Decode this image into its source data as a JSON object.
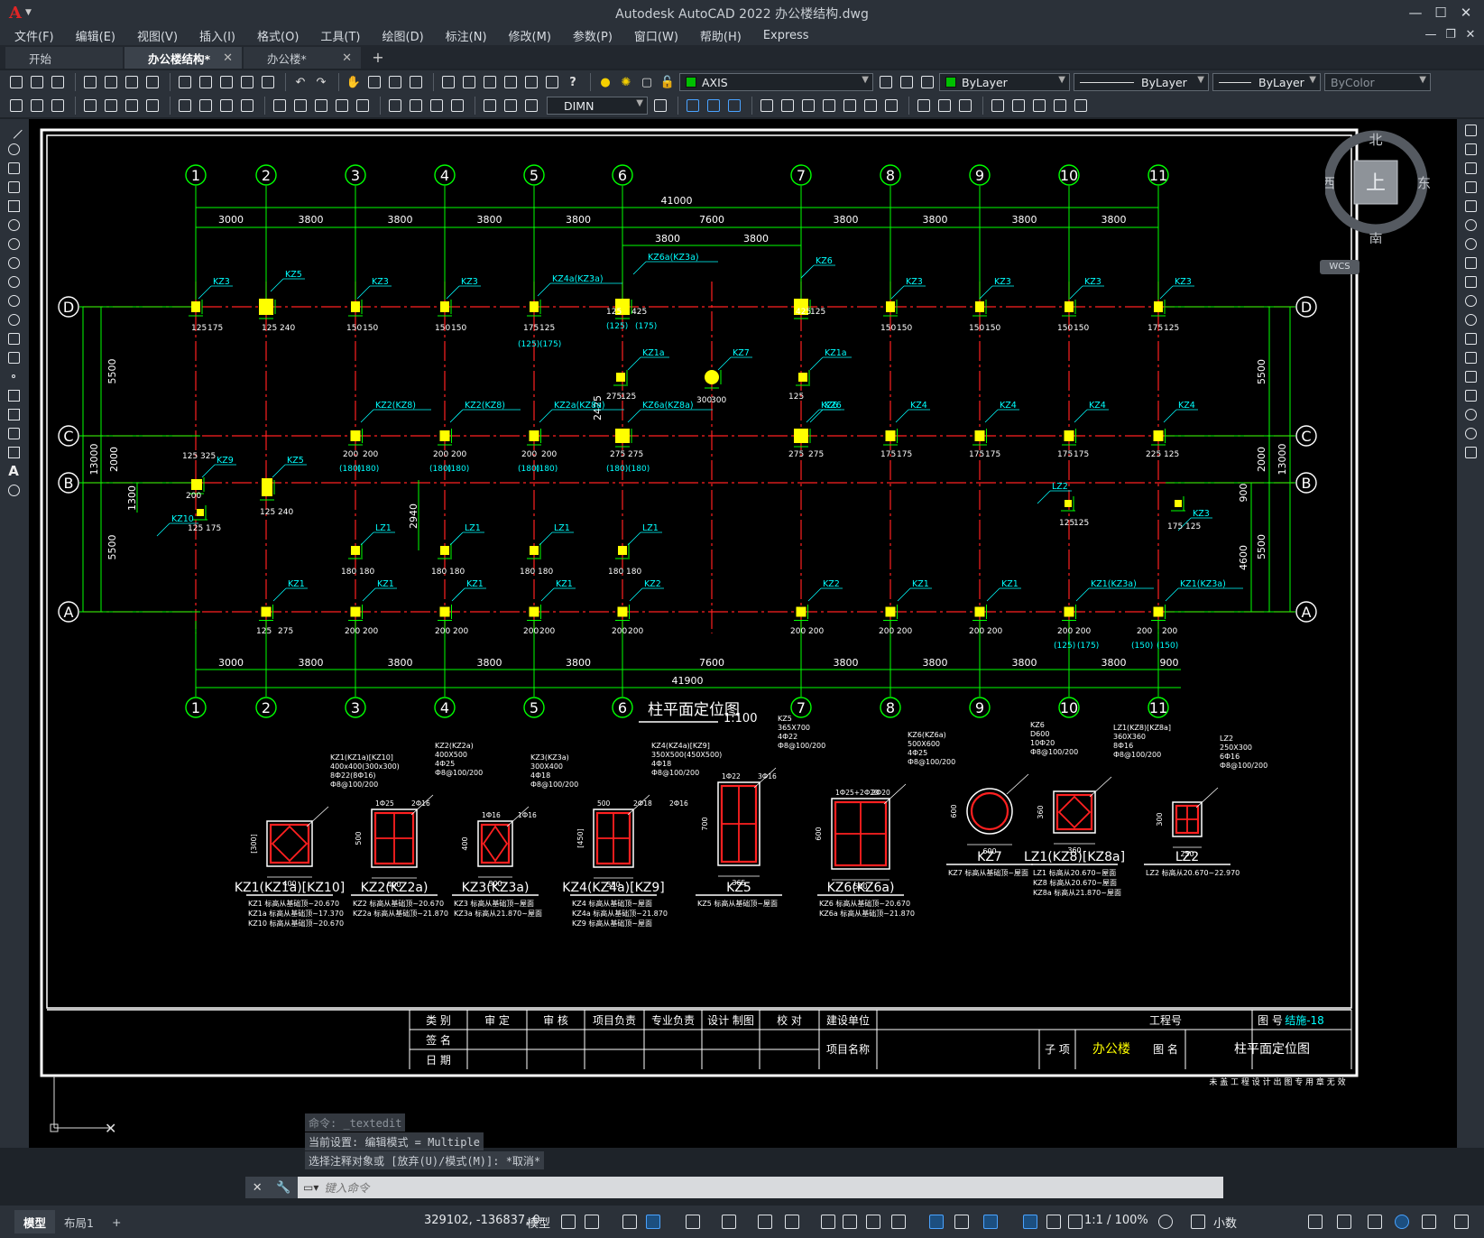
{
  "app": {
    "logo": "A",
    "title": "Autodesk AutoCAD 2022    办公楼结构.dwg"
  },
  "menu": [
    "文件(F)",
    "编辑(E)",
    "视图(V)",
    "插入(I)",
    "格式(O)",
    "工具(T)",
    "绘图(D)",
    "标注(N)",
    "修改(M)",
    "参数(P)",
    "窗口(W)",
    "帮助(H)",
    "Express"
  ],
  "tabs": [
    {
      "label": "开始",
      "active": false,
      "closable": false
    },
    {
      "label": "办公楼结构*",
      "active": true,
      "closable": true
    },
    {
      "label": "办公楼*",
      "active": false,
      "closable": true
    }
  ],
  "toolbar": {
    "layer": "AXIS",
    "color": "ByLayer",
    "linetype": "ByLayer",
    "lineweight": "ByLayer",
    "plotstyle": "ByColor",
    "dimstyle": "DIMN",
    "layer_color": "#00c000"
  },
  "viewcube": {
    "north": "北",
    "south": "南",
    "west": "西",
    "east": "东",
    "top": "上",
    "wcs": "WCS"
  },
  "drawing": {
    "axis_numbers": [
      "1",
      "2",
      "3",
      "4",
      "5",
      "6",
      "7",
      "8",
      "9",
      "10",
      "11"
    ],
    "axis_letters": [
      "D",
      "C",
      "B",
      "A"
    ],
    "top_total": "41000",
    "bottom_total": "41900",
    "spans_top": [
      "3000",
      "3800",
      "3800",
      "3800",
      "3800",
      "7600",
      "3800",
      "3800",
      "3800",
      "3800"
    ],
    "spans_bottom": [
      "3000",
      "3800",
      "3800",
      "3800",
      "3800",
      "7600",
      "3800",
      "3800",
      "3800",
      "3800",
      "900"
    ],
    "sub_spans": [
      "3800",
      "3800"
    ],
    "left_dims": [
      "5500",
      "2000",
      "13000",
      "1300",
      "5500"
    ],
    "right_dims": [
      "5500",
      "2000",
      "13000",
      "900",
      "4600",
      "5500"
    ],
    "mid_dims": [
      "2940",
      "2425"
    ],
    "plan_title": "柱平面定位图",
    "plan_scale": "1:100",
    "col_labels_row_d": [
      "KZ3",
      "KZ5",
      "KZ3",
      "KZ3",
      "KZ4a(KZ3a)",
      "KZ6a(KZ3a)",
      "KZ6",
      "KZ3",
      "KZ3",
      "KZ3",
      "KZ3"
    ],
    "col_labels_row_c": [
      "KZ2(KZ8)",
      "KZ2(KZ8)",
      "KZ2a(KZ8a)",
      "KZ6a(KZ8a)",
      "KZ6",
      "KZ4",
      "KZ4",
      "KZ4",
      "KZ4"
    ],
    "col_labels_row_a": [
      "KZ1",
      "KZ1",
      "KZ1",
      "KZ1",
      "KZ2",
      "KZ2",
      "KZ1",
      "KZ1",
      "KZ1(KZ3a)",
      "KZ1(KZ3a)"
    ],
    "sections": [
      {
        "name": "KZ1(KZ1a)[KZ10]",
        "spec": "KZ1(KZ1a)[KZ10]\n400x400(300x300)\n8Ф22(8Ф16)\nФ8@100/200",
        "dims": [
          "400",
          "[300]"
        ],
        "notes": [
          "KZ1 标高从基础顶~20.670",
          "KZ1a 标高从基础顶~17.370",
          "KZ10 标高从基础顶~20.670"
        ]
      },
      {
        "name": "KZ2(KZ2a)",
        "spec": "KZ2(KZ2a)\n400X500\n4Ф25\nФ8@100/200",
        "dims": [
          "400",
          "500",
          "1Ф25",
          "2Ф16"
        ],
        "notes": [
          "KZ2 标高从基础顶~20.670",
          "KZ2a 标高从基础顶~21.870"
        ]
      },
      {
        "name": "KZ3(KZ3a)",
        "spec": "KZ3(KZ3a)\n300X400\n4Ф18\nФ8@100/200",
        "dims": [
          "300",
          "400",
          "1Ф16",
          "1Ф16"
        ],
        "notes": [
          "KZ3 标高从基础顶~屋面",
          "KZ3a 标高从21.870~屋面"
        ]
      },
      {
        "name": "KZ4(KZ4a)[KZ9]",
        "spec": "KZ4(KZ4a)[KZ9]\n350X500(450X500)\n4Ф18\nФ8@100/200",
        "dims": [
          "350",
          "[450]",
          "500",
          "2Ф18",
          "2Ф16"
        ],
        "notes": [
          "KZ4 标高从基础顶~屋面",
          "KZ4a 标高从基础顶~21.870",
          "KZ9 标高从基础顶~屋面"
        ]
      },
      {
        "name": "KZ5",
        "spec": "KZ5\n365X700\n4Ф22\nФ8@100/200",
        "dims": [
          "365",
          "700",
          "1Ф22",
          "3Ф16"
        ],
        "notes": [
          "KZ5 标高从基础顶~屋面"
        ]
      },
      {
        "name": "KZ6(KZ6a)",
        "spec": "KZ6(KZ6a)\n500X600\n4Ф25\nФ8@100/200",
        "dims": [
          "500",
          "600",
          "1Ф25+2Ф20",
          "2Ф20"
        ],
        "notes": [
          "KZ6 标高从基础顶~20.670",
          "KZ6a 标高从基础顶~21.870"
        ]
      },
      {
        "name": "KZ7",
        "spec": "KZ6\nD600\n10Ф20\nФ8@100/200",
        "dims": [
          "600",
          "600"
        ],
        "notes": [
          "KZ7 标高从基础顶~屋面"
        ]
      },
      {
        "name": "LZ1(KZ8)[KZ8a]",
        "spec": "LZ1(KZ8)[KZ8a]\n360X360\n8Ф16\nФ8@100/200",
        "dims": [
          "360",
          "360"
        ],
        "notes": [
          "LZ1 标高从20.670~屋面",
          "KZ8 标高从20.670~屋面",
          "KZ8a 标高从21.870~屋面"
        ]
      },
      {
        "name": "LZ2",
        "spec": "LZ2\n250X300\n6Ф16\nФ8@100/200",
        "dims": [
          "250",
          "300"
        ],
        "notes": [
          "LZ2 标高从20.670~22.970"
        ]
      }
    ],
    "title_block": {
      "row1": [
        "类 别",
        "审 定",
        "审 核",
        "项目负责",
        "专业负责",
        "设计 制图",
        "校 对",
        "建设单位",
        "工程号",
        "图 号",
        "结施-18"
      ],
      "row2": [
        "签 名"
      ],
      "row3": [
        "日 期"
      ],
      "project_label": "项目名称",
      "sub_item": "子 项",
      "sub_item_value": "办公楼",
      "drawing_name_label": "图 名",
      "drawing_name": "柱平面定位图",
      "footer": "未 盖 工 程 设 计 出 图 专 用 章 无 效"
    }
  },
  "command": {
    "history": [
      "命令: _textedit",
      "当前设置: 编辑模式 = Multiple",
      "选择注释对象或 [放弃(U)/模式(M)]: *取消*"
    ],
    "placeholder": "键入命令"
  },
  "status": {
    "layouts": [
      {
        "label": "模型",
        "active": true
      },
      {
        "label": "布局1",
        "active": false
      }
    ],
    "coords": "329102, -136837, 0",
    "space": "模型",
    "scale": "1:1 / 100%",
    "units": "小数"
  }
}
